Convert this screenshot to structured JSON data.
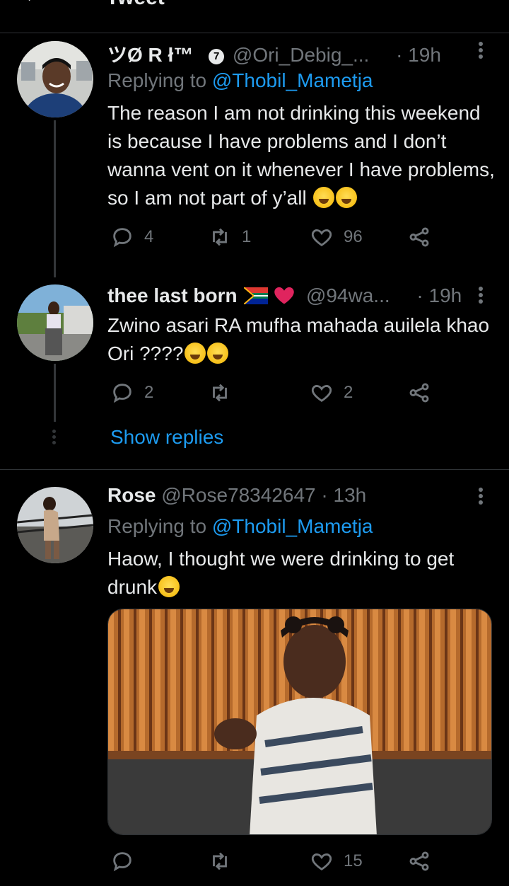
{
  "header": {
    "title": "Tweet"
  },
  "tweets": [
    {
      "name": "ツØ R ł™",
      "badge": "7",
      "handle": "@Ori_Debig_...",
      "time": "· 19h",
      "replying_label": "Replying to",
      "replying_to": "@Thobil_Mametja",
      "text": "The reason I am not drinking this weekend is because I have problems and I don’t wanna vent on it whenever I have problems, so I am not part of y’all",
      "emoji": [
        "rolling-laughing-emoji",
        "rolling-laughing-emoji"
      ],
      "replies": "4",
      "retweets": "1",
      "likes": "96"
    },
    {
      "name": "thee last born",
      "handle": "@94wa...",
      "time": "· 19h",
      "text": "Zwino asari RA mufha mahada auilela khao Ori ????",
      "emoji": [
        "tears-of-joy-emoji",
        "tears-of-joy-emoji"
      ],
      "replies": "2",
      "retweets": "",
      "likes": "2"
    },
    {
      "name": "Rose",
      "handle": "@Rose78342647",
      "time": "· 13h",
      "replying_label": "Replying to",
      "replying_to": "@Thobil_Mametja",
      "text": "Haow, I thought we were drinking to get drunk",
      "emoji": [
        "woozy-face-emoji"
      ],
      "replies": "",
      "retweets": "",
      "likes": "15"
    }
  ],
  "show_replies": "Show replies",
  "colors": {
    "accent": "#1d9bf0",
    "muted": "#71767b",
    "text": "#e7e9ea",
    "bg": "#000000"
  }
}
